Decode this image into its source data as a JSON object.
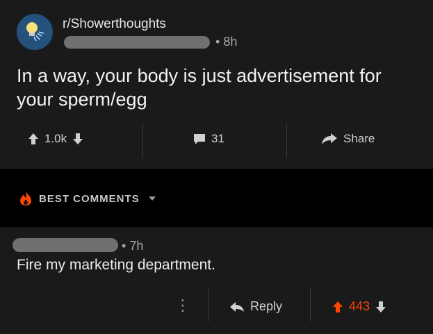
{
  "post": {
    "subreddit": "r/Showerthoughts",
    "time": "8h",
    "title": "In a way, your body is just advertisement for your sperm/egg",
    "upvotes": "1.0k",
    "comments": "31",
    "share_label": "Share"
  },
  "sort": {
    "label": "BEST COMMENTS"
  },
  "comment": {
    "time": "7h",
    "body": "Fire my marketing department.",
    "more_label": "⋮",
    "reply_label": "Reply",
    "score": "443"
  },
  "colors": {
    "upvote": "#ff4500",
    "subreddit_icon_bg": "#24527d"
  }
}
